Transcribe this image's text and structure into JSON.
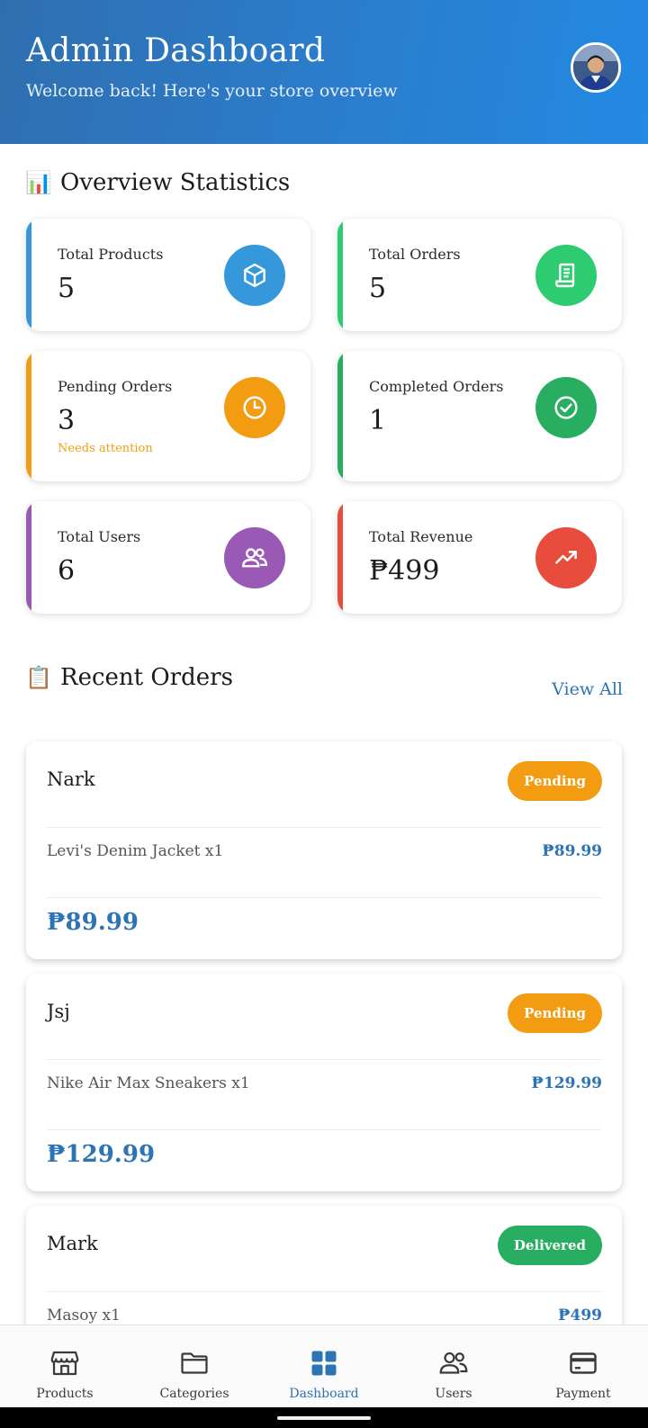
{
  "header": {
    "title": "Admin Dashboard",
    "subtitle": "Welcome back! Here's your store overview",
    "colors": {
      "gradient_start": "#2f6fb0",
      "gradient_end": "#2389e3"
    }
  },
  "overview": {
    "emoji": "📊",
    "title": "Overview Statistics",
    "stats": [
      {
        "label": "Total Products",
        "value": "5",
        "icon": "cube-icon",
        "color": "#3498db"
      },
      {
        "label": "Total Orders",
        "value": "5",
        "icon": "receipt-icon",
        "color": "#2ecc71"
      },
      {
        "label": "Pending Orders",
        "value": "3",
        "note": "Needs attention",
        "icon": "clock-icon",
        "color": "#f39c12"
      },
      {
        "label": "Completed Orders",
        "value": "1",
        "icon": "check-circle-icon",
        "color": "#27ae60"
      },
      {
        "label": "Total Users",
        "value": "6",
        "icon": "users-icon",
        "color": "#9b59b6"
      },
      {
        "label": "Total Revenue",
        "value": "₱499",
        "icon": "trending-up-icon",
        "color": "#e74c3c"
      }
    ]
  },
  "recent_orders": {
    "emoji": "📋",
    "title": "Recent Orders",
    "view_all": "View All",
    "orders": [
      {
        "customer": "Nark",
        "status": "Pending",
        "status_color": "#f39c12",
        "item": "Levi's Denim Jacket x1",
        "item_price": "₱89.99",
        "total": "₱89.99"
      },
      {
        "customer": "Jsj",
        "status": "Pending",
        "status_color": "#f39c12",
        "item": "Nike Air Max Sneakers x1",
        "item_price": "₱129.99",
        "total": "₱129.99"
      },
      {
        "customer": "Mark",
        "status": "Delivered",
        "status_color": "#27ae60",
        "item": "Masoy x1",
        "item_price": "₱499"
      }
    ]
  },
  "bottom_nav": {
    "items": [
      {
        "label": "Products",
        "icon": "store-icon"
      },
      {
        "label": "Categories",
        "icon": "folder-icon"
      },
      {
        "label": "Dashboard",
        "icon": "grid-icon",
        "active": true
      },
      {
        "label": "Users",
        "icon": "users-icon"
      },
      {
        "label": "Payment",
        "icon": "credit-card-icon"
      }
    ],
    "active_color": "#2c74b3"
  }
}
